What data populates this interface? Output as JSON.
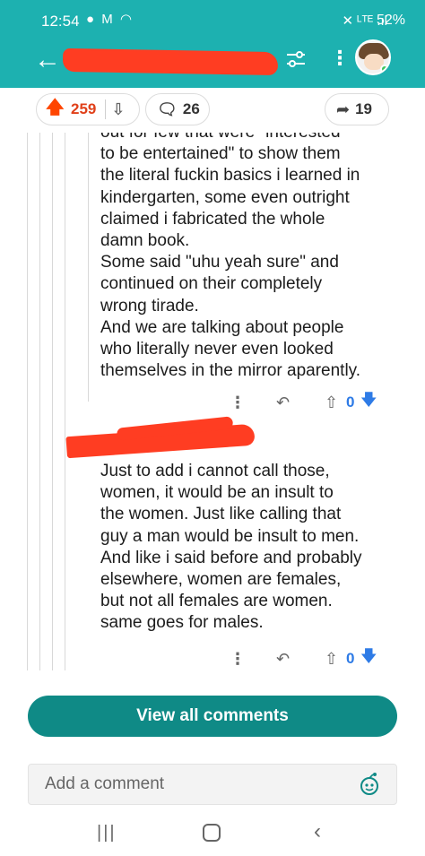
{
  "status_bar": {
    "time": "12:54",
    "left_icons": "● M ◠",
    "right_icons": "✕ ᴸᵀᴱ .ıl",
    "battery": "52%"
  },
  "header": {
    "back_icon": "back-arrow-icon",
    "settings_icon": "sliders-icon",
    "more_icon": "more-icon"
  },
  "post_actions": {
    "upvote_count": "259",
    "comment_count": "26",
    "share_count": "19"
  },
  "comments": [
    {
      "text": "out for few that were \"interested\nto be entertained\" to show them\nthe literal fuckin basics i learned in\nkindergarten, some even outright\nclaimed i fabricated the whole\ndamn book.\nSome said \"uhu yeah sure\" and\ncontinued on their completely\nwrong tirade.\nAnd we are talking about people\nwho literally never even looked\nthemselves in the mirror aparently.",
      "score": "0"
    },
    {
      "text": "Just to add i cannot call those,\nwomen, it would be an insult to\nthe women. Just like calling that\nguy a man would be insult to men.\nAnd like i said before and probably\nelsewhere, women are females,\nbut not all females are women.\nsame goes for males.",
      "score": "0"
    }
  ],
  "footer": {
    "view_all": "View all comments",
    "add_comment_placeholder": "Add a comment"
  },
  "colors": {
    "header_teal": "#1db1b0",
    "button_teal": "#0f8a86",
    "upvote_orange": "#ff4500",
    "vote_blue": "#2e7be6"
  }
}
